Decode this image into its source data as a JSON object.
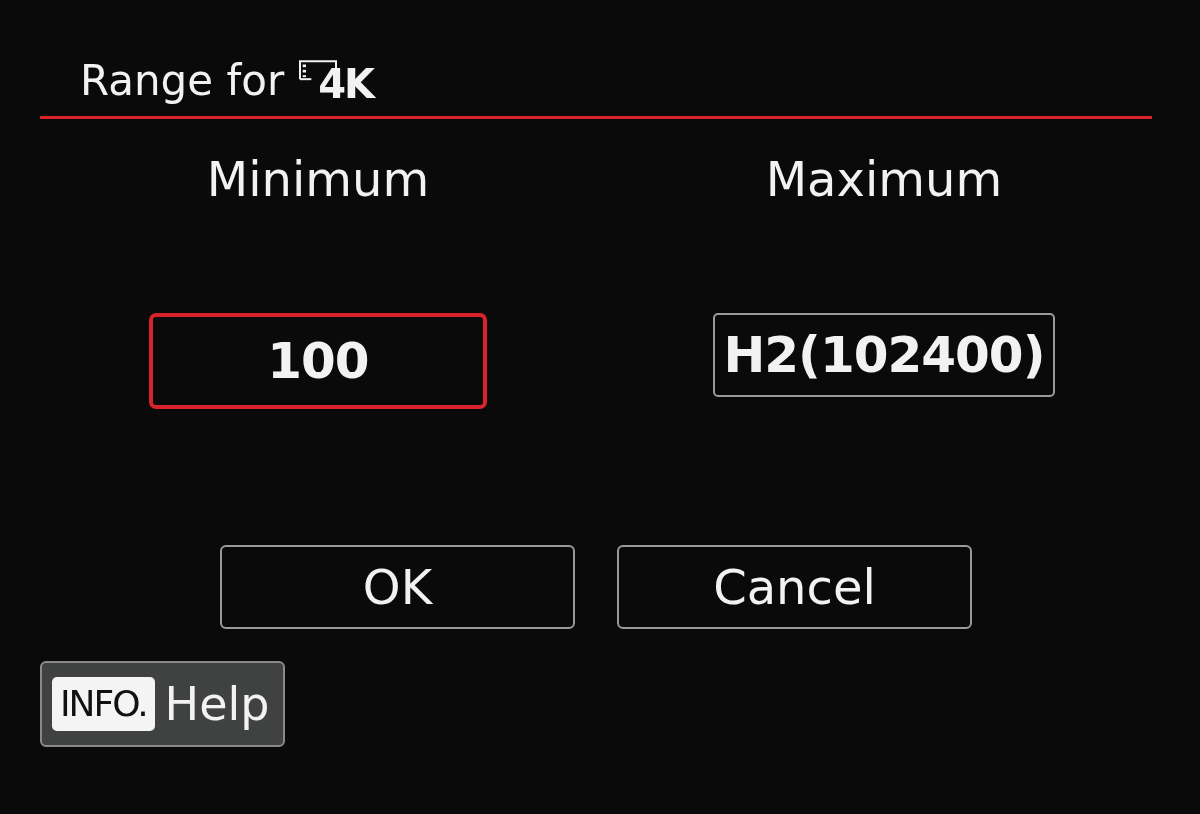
{
  "title": {
    "text": "Range for",
    "badge": "4K"
  },
  "fields": [
    {
      "label": "Minimum",
      "value": "100",
      "selected": true
    },
    {
      "label": "Maximum",
      "value": "H2(102400)",
      "selected": false
    }
  ],
  "buttons": [
    {
      "label": "OK",
      "selected": false
    },
    {
      "label": "Cancel",
      "selected": false
    }
  ],
  "help": {
    "key": "INFO.",
    "label": "Help"
  }
}
